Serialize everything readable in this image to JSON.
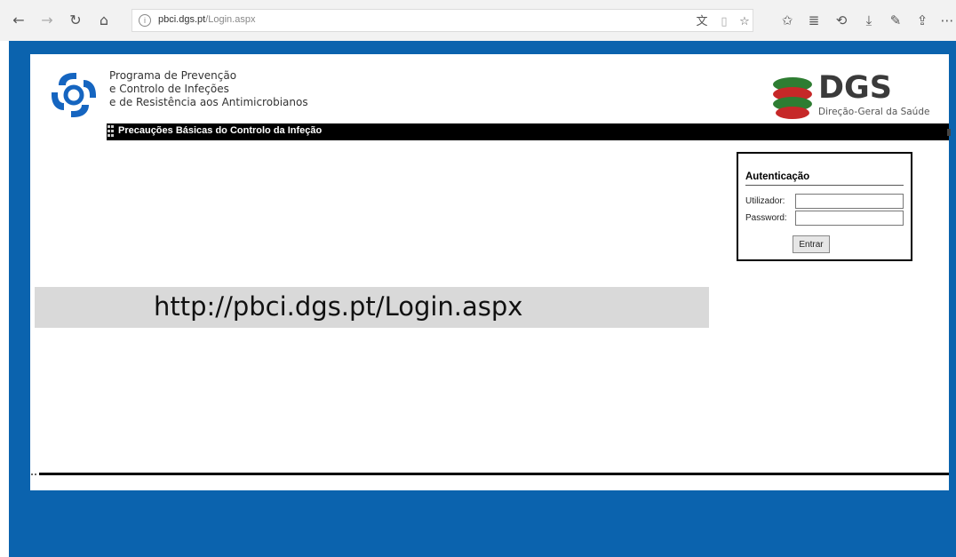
{
  "browser": {
    "url_domain": "pbci.dgs.pt",
    "url_path": "/Login.aspx",
    "icons": {
      "back": "back-arrow-icon",
      "forward": "forward-arrow-icon",
      "refresh": "refresh-icon",
      "home": "home-icon",
      "info": "info-icon",
      "translate": "translate-icon",
      "reading_view": "reading-view-icon",
      "favorite": "star-icon",
      "favorites_list": "favorites-list-icon",
      "reading_list": "reading-list-icon",
      "history": "history-icon",
      "downloads": "download-icon",
      "notes": "pen-icon",
      "share": "share-icon",
      "more": "more-icon"
    }
  },
  "header": {
    "ppci_lines": [
      "Programa de Prevenção",
      "e Controlo de Infeções",
      "e de Resistência aos Antimicrobianos"
    ],
    "dgs_title": "DGS",
    "dgs_subtitle": "Direção-Geral da Saúde"
  },
  "band": {
    "title": "Precauções Básicas do Controlo da Infeção"
  },
  "login": {
    "title": "Autenticação",
    "user_label": "Utilizador:",
    "password_label": "Password:",
    "user_value": "",
    "password_value": "",
    "submit_label": "Entrar"
  },
  "caption": {
    "text": "http://pbci.dgs.pt/Login.aspx"
  },
  "colors": {
    "frame_blue": "#0b63ae",
    "band_black": "#000000",
    "caption_gray": "#d9d9d9",
    "dgs_green": "#2e7d32",
    "dgs_red": "#c62828"
  }
}
